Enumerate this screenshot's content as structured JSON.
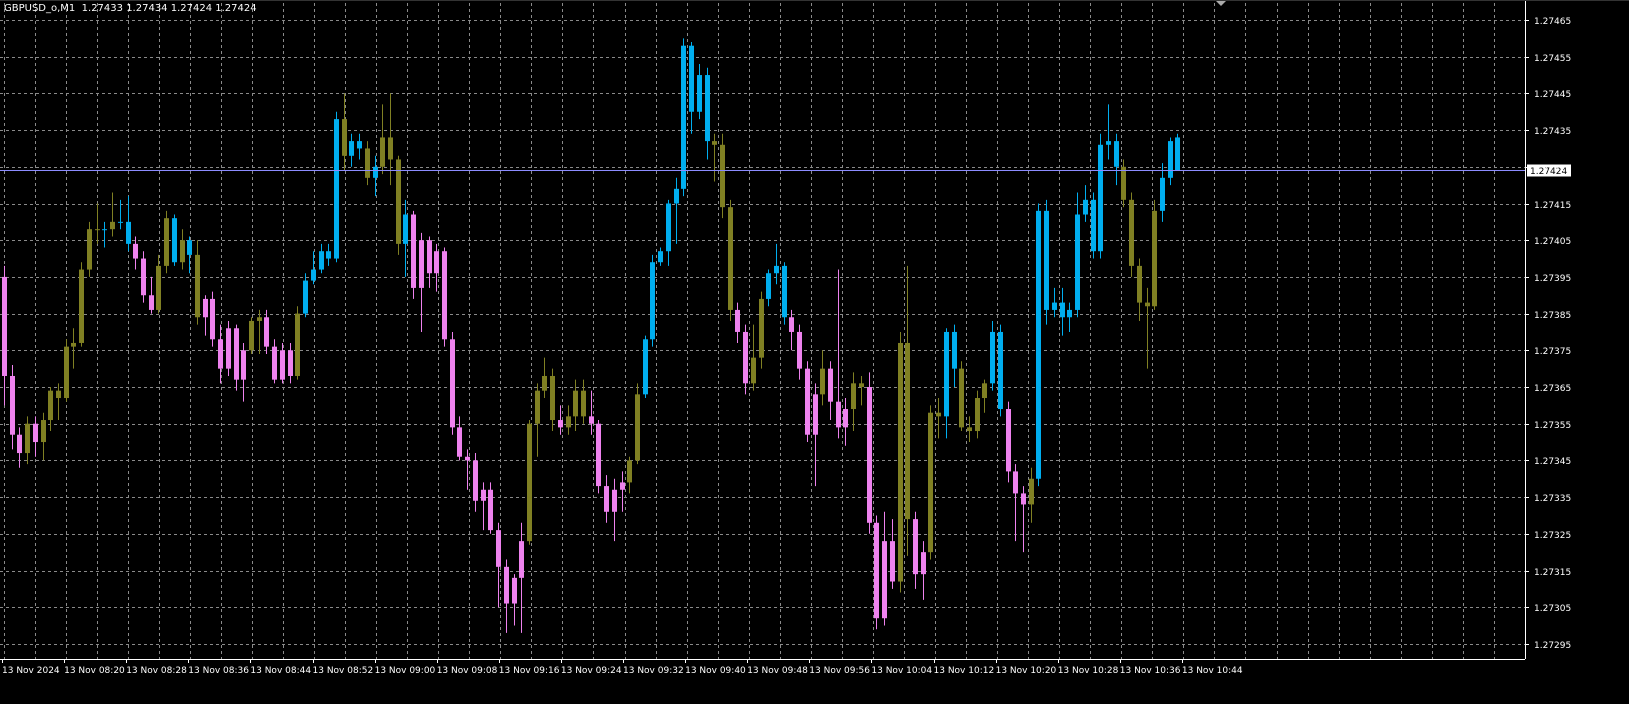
{
  "header": {
    "symbol": "GBPUSD_o,M1",
    "ohlc": "1.27433 1.27434 1.27424 1.27424"
  },
  "current_price_label": "1.27424",
  "colors": {
    "background": "#000000",
    "grid": "#8a8a8a",
    "text": "#ffffff",
    "bull_strong": "#00aeef",
    "bear_strong": "#ee82ee",
    "neutral": "#808023",
    "price_line": "#8c8cff"
  },
  "chart_data": {
    "type": "candlestick",
    "timeframe": "M1",
    "symbol": "GBPUSD_o",
    "y_ticks": [
      "1.27465",
      "1.27455",
      "1.27445",
      "1.27435",
      "1.27425",
      "1.27415",
      "1.27405",
      "1.27395",
      "1.27385",
      "1.27375",
      "1.27365",
      "1.27355",
      "1.27345",
      "1.27335",
      "1.27325",
      "1.27315",
      "1.27305",
      "1.27295"
    ],
    "x_ticks": [
      "13 Nov 2024",
      "13 Nov 08:20",
      "13 Nov 08:28",
      "13 Nov 08:36",
      "13 Nov 08:44",
      "13 Nov 08:52",
      "13 Nov 09:00",
      "13 Nov 09:08",
      "13 Nov 09:16",
      "13 Nov 09:24",
      "13 Nov 09:32",
      "13 Nov 09:40",
      "13 Nov 09:48",
      "13 Nov 09:56",
      "13 Nov 10:04",
      "13 Nov 10:12",
      "13 Nov 10:20",
      "13 Nov 10:28",
      "13 Nov 10:36",
      "13 Nov 10:44"
    ],
    "ylim": [
      1.2729,
      1.27468
    ],
    "grid": true,
    "current_price": 1.27424,
    "candles": [
      [
        1.27395,
        1.27398,
        1.2736,
        1.27368,
        "b"
      ],
      [
        1.27368,
        1.27371,
        1.27348,
        1.27352,
        "b"
      ],
      [
        1.27352,
        1.27354,
        1.27343,
        1.27347,
        "b"
      ],
      [
        1.27347,
        1.27357,
        1.27344,
        1.27355,
        "n"
      ],
      [
        1.27355,
        1.27357,
        1.27346,
        1.2735,
        "b"
      ],
      [
        1.2735,
        1.27358,
        1.27345,
        1.27356,
        "n"
      ],
      [
        1.27356,
        1.27365,
        1.27353,
        1.27364,
        "n"
      ],
      [
        1.27364,
        1.27366,
        1.27356,
        1.27362,
        "n"
      ],
      [
        1.27362,
        1.27378,
        1.27361,
        1.27376,
        "n"
      ],
      [
        1.27376,
        1.27381,
        1.2737,
        1.27377,
        "n"
      ],
      [
        1.27377,
        1.27399,
        1.27376,
        1.27397,
        "n"
      ],
      [
        1.27397,
        1.2741,
        1.27395,
        1.27408,
        "n"
      ],
      [
        1.27408,
        1.27415,
        1.27404,
        1.27408,
        "n"
      ],
      [
        1.27408,
        1.2741,
        1.27403,
        1.27408,
        "u"
      ],
      [
        1.27408,
        1.27418,
        1.27406,
        1.2741,
        "n"
      ],
      [
        1.2741,
        1.27416,
        1.27408,
        1.2741,
        "u"
      ],
      [
        1.2741,
        1.27417,
        1.27402,
        1.27404,
        "u"
      ],
      [
        1.27404,
        1.27406,
        1.27397,
        1.274,
        "b"
      ],
      [
        1.274,
        1.27402,
        1.27388,
        1.2739,
        "b"
      ],
      [
        1.2739,
        1.27395,
        1.27385,
        1.27386,
        "b"
      ],
      [
        1.27386,
        1.27401,
        1.27385,
        1.27398,
        "n"
      ],
      [
        1.27398,
        1.27413,
        1.27396,
        1.27411,
        "n"
      ],
      [
        1.27411,
        1.27412,
        1.27398,
        1.27399,
        "u"
      ],
      [
        1.27399,
        1.27408,
        1.27397,
        1.27405,
        "n"
      ],
      [
        1.27405,
        1.27406,
        1.27396,
        1.27401,
        "u"
      ],
      [
        1.27401,
        1.27405,
        1.27382,
        1.27384,
        "n"
      ],
      [
        1.27384,
        1.2739,
        1.27379,
        1.27389,
        "b"
      ],
      [
        1.27389,
        1.27391,
        1.27376,
        1.27378,
        "b"
      ],
      [
        1.27378,
        1.27382,
        1.27366,
        1.2737,
        "b"
      ],
      [
        1.2737,
        1.27383,
        1.27368,
        1.27381,
        "b"
      ],
      [
        1.27381,
        1.27382,
        1.27364,
        1.27367,
        "b"
      ],
      [
        1.27367,
        1.27377,
        1.27361,
        1.27375,
        "b"
      ],
      [
        1.27375,
        1.27384,
        1.27374,
        1.27383,
        "n"
      ],
      [
        1.27383,
        1.27386,
        1.27374,
        1.27384,
        "n"
      ],
      [
        1.27384,
        1.27386,
        1.27374,
        1.27376,
        "b"
      ],
      [
        1.27376,
        1.27378,
        1.27366,
        1.27367,
        "b"
      ],
      [
        1.27367,
        1.27377,
        1.27366,
        1.27375,
        "b"
      ],
      [
        1.27375,
        1.27377,
        1.27366,
        1.27368,
        "b"
      ],
      [
        1.27368,
        1.27387,
        1.27367,
        1.27385,
        "n"
      ],
      [
        1.27385,
        1.27396,
        1.27384,
        1.27394,
        "u"
      ],
      [
        1.27394,
        1.27402,
        1.27393,
        1.27397,
        "u"
      ],
      [
        1.27397,
        1.27404,
        1.27396,
        1.27402,
        "u"
      ],
      [
        1.27402,
        1.27404,
        1.27398,
        1.274,
        "u"
      ],
      [
        1.274,
        1.2744,
        1.27399,
        1.27438,
        "u"
      ],
      [
        1.27438,
        1.27445,
        1.27424,
        1.27428,
        "n"
      ],
      [
        1.27428,
        1.27434,
        1.27425,
        1.27432,
        "u"
      ],
      [
        1.27432,
        1.27434,
        1.27427,
        1.2743,
        "u"
      ],
      [
        1.2743,
        1.27432,
        1.2742,
        1.27422,
        "n"
      ],
      [
        1.27422,
        1.27428,
        1.27417,
        1.27425,
        "u"
      ],
      [
        1.27425,
        1.27442,
        1.27423,
        1.27433,
        "n"
      ],
      [
        1.27433,
        1.27445,
        1.2742,
        1.27427,
        "n"
      ],
      [
        1.27427,
        1.27428,
        1.27401,
        1.27404,
        "n"
      ],
      [
        1.27404,
        1.27416,
        1.27395,
        1.27412,
        "u"
      ],
      [
        1.27412,
        1.27413,
        1.27389,
        1.27392,
        "b"
      ],
      [
        1.27392,
        1.27407,
        1.2738,
        1.27405,
        "b"
      ],
      [
        1.27405,
        1.27406,
        1.27392,
        1.27396,
        "b"
      ],
      [
        1.27396,
        1.27404,
        1.27391,
        1.27402,
        "b"
      ],
      [
        1.27402,
        1.27403,
        1.27376,
        1.27378,
        "b"
      ],
      [
        1.27378,
        1.2738,
        1.27352,
        1.27354,
        "b"
      ],
      [
        1.27354,
        1.27357,
        1.27345,
        1.27346,
        "b"
      ],
      [
        1.27346,
        1.27348,
        1.27337,
        1.27345,
        "b"
      ],
      [
        1.27345,
        1.27347,
        1.27331,
        1.27334,
        "b"
      ],
      [
        1.27334,
        1.27339,
        1.27326,
        1.27337,
        "b"
      ],
      [
        1.27337,
        1.27339,
        1.27325,
        1.27326,
        "b"
      ],
      [
        1.27326,
        1.27328,
        1.27305,
        1.27316,
        "b"
      ],
      [
        1.27316,
        1.27318,
        1.27298,
        1.27306,
        "b"
      ],
      [
        1.27306,
        1.27314,
        1.273,
        1.27313,
        "b"
      ],
      [
        1.27313,
        1.27328,
        1.27298,
        1.27323,
        "b"
      ],
      [
        1.27323,
        1.27356,
        1.27322,
        1.27355,
        "n"
      ],
      [
        1.27355,
        1.27366,
        1.27346,
        1.27364,
        "n"
      ],
      [
        1.27364,
        1.27373,
        1.27362,
        1.27368,
        "n"
      ],
      [
        1.27368,
        1.2737,
        1.27353,
        1.27356,
        "n"
      ],
      [
        1.27356,
        1.2736,
        1.27352,
        1.27354,
        "b"
      ],
      [
        1.27354,
        1.2736,
        1.27352,
        1.27357,
        "n"
      ],
      [
        1.27357,
        1.27367,
        1.27353,
        1.27364,
        "n"
      ],
      [
        1.27364,
        1.27367,
        1.27355,
        1.27357,
        "n"
      ],
      [
        1.27357,
        1.27364,
        1.27352,
        1.27355,
        "b"
      ],
      [
        1.27355,
        1.27356,
        1.27336,
        1.27338,
        "b"
      ],
      [
        1.27338,
        1.27341,
        1.27328,
        1.27331,
        "b"
      ],
      [
        1.27331,
        1.2734,
        1.27323,
        1.27337,
        "b"
      ],
      [
        1.27337,
        1.27342,
        1.27331,
        1.27339,
        "b"
      ],
      [
        1.27339,
        1.27346,
        1.27336,
        1.27345,
        "n"
      ],
      [
        1.27345,
        1.27366,
        1.27344,
        1.27363,
        "n"
      ],
      [
        1.27363,
        1.27379,
        1.27362,
        1.27378,
        "u"
      ],
      [
        1.27378,
        1.27401,
        1.27376,
        1.27399,
        "u"
      ],
      [
        1.27399,
        1.27403,
        1.27398,
        1.27402,
        "u"
      ],
      [
        1.27402,
        1.27416,
        1.27398,
        1.27415,
        "u"
      ],
      [
        1.27415,
        1.27422,
        1.27404,
        1.27419,
        "u"
      ],
      [
        1.27419,
        1.2746,
        1.27417,
        1.27458,
        "u"
      ],
      [
        1.27458,
        1.27459,
        1.27434,
        1.2744,
        "u"
      ],
      [
        1.2744,
        1.27453,
        1.27438,
        1.2745,
        "u"
      ],
      [
        1.2745,
        1.27452,
        1.27427,
        1.27432,
        "u"
      ],
      [
        1.27432,
        1.27434,
        1.27421,
        1.27431,
        "n"
      ],
      [
        1.27431,
        1.27434,
        1.27411,
        1.27414,
        "n"
      ],
      [
        1.27414,
        1.27416,
        1.27383,
        1.27386,
        "n"
      ],
      [
        1.27386,
        1.27388,
        1.27377,
        1.2738,
        "b"
      ],
      [
        1.2738,
        1.27382,
        1.27363,
        1.27366,
        "b"
      ],
      [
        1.27366,
        1.27382,
        1.27364,
        1.27373,
        "n"
      ],
      [
        1.27373,
        1.27391,
        1.2737,
        1.27389,
        "n"
      ],
      [
        1.27389,
        1.27397,
        1.27387,
        1.27396,
        "u"
      ],
      [
        1.27396,
        1.27404,
        1.27393,
        1.27398,
        "u"
      ],
      [
        1.27398,
        1.27399,
        1.27382,
        1.27384,
        "u"
      ],
      [
        1.27384,
        1.27386,
        1.27375,
        1.2738,
        "b"
      ],
      [
        1.2738,
        1.27382,
        1.27367,
        1.2737,
        "b"
      ],
      [
        1.2737,
        1.27372,
        1.2735,
        1.27352,
        "b"
      ],
      [
        1.27352,
        1.27366,
        1.27338,
        1.27363,
        "b"
      ],
      [
        1.27363,
        1.27375,
        1.2736,
        1.2737,
        "n"
      ],
      [
        1.2737,
        1.27372,
        1.27356,
        1.27361,
        "b"
      ],
      [
        1.27361,
        1.27397,
        1.27351,
        1.27354,
        "b"
      ],
      [
        1.27354,
        1.27362,
        1.27349,
        1.27359,
        "b"
      ],
      [
        1.27359,
        1.27369,
        1.27353,
        1.27366,
        "n"
      ],
      [
        1.27366,
        1.27368,
        1.2736,
        1.27365,
        "n"
      ],
      [
        1.27365,
        1.27369,
        1.27325,
        1.27328,
        "b"
      ],
      [
        1.27328,
        1.2733,
        1.27299,
        1.27302,
        "b"
      ],
      [
        1.27302,
        1.27331,
        1.273,
        1.27323,
        "b"
      ],
      [
        1.27323,
        1.27329,
        1.2731,
        1.27312,
        "b"
      ],
      [
        1.27312,
        1.2738,
        1.27309,
        1.27377,
        "n"
      ],
      [
        1.27377,
        1.27398,
        1.27319,
        1.27329,
        "n"
      ],
      [
        1.27329,
        1.27331,
        1.2731,
        1.27314,
        "b"
      ],
      [
        1.27314,
        1.27323,
        1.27307,
        1.2732,
        "b"
      ],
      [
        1.2732,
        1.2736,
        1.27318,
        1.27358,
        "n"
      ],
      [
        1.27358,
        1.27362,
        1.27351,
        1.27357,
        "n"
      ],
      [
        1.27357,
        1.27381,
        1.27351,
        1.2738,
        "u"
      ],
      [
        1.2738,
        1.27382,
        1.27365,
        1.2737,
        "u"
      ],
      [
        1.2737,
        1.27372,
        1.27353,
        1.27354,
        "n"
      ],
      [
        1.27354,
        1.27357,
        1.2735,
        1.27353,
        "n"
      ],
      [
        1.27353,
        1.27364,
        1.27351,
        1.27362,
        "n"
      ],
      [
        1.27362,
        1.27367,
        1.27358,
        1.27366,
        "n"
      ],
      [
        1.27366,
        1.27383,
        1.27364,
        1.2738,
        "u"
      ],
      [
        1.2738,
        1.27382,
        1.27357,
        1.27359,
        "u"
      ],
      [
        1.27359,
        1.27361,
        1.27339,
        1.27342,
        "b"
      ],
      [
        1.27342,
        1.27344,
        1.27323,
        1.27336,
        "b"
      ],
      [
        1.27336,
        1.27338,
        1.2732,
        1.27333,
        "b"
      ],
      [
        1.27333,
        1.27343,
        1.27328,
        1.2734,
        "n"
      ],
      [
        1.2734,
        1.27415,
        1.27338,
        1.27413,
        "u"
      ],
      [
        1.27413,
        1.27416,
        1.27382,
        1.27386,
        "u"
      ],
      [
        1.27386,
        1.27392,
        1.27384,
        1.27388,
        "u"
      ],
      [
        1.27388,
        1.27392,
        1.27379,
        1.27384,
        "u"
      ],
      [
        1.27384,
        1.27388,
        1.2738,
        1.27386,
        "u"
      ],
      [
        1.27386,
        1.27418,
        1.27384,
        1.27412,
        "u"
      ],
      [
        1.27412,
        1.2742,
        1.2741,
        1.27416,
        "u"
      ],
      [
        1.27416,
        1.27418,
        1.274,
        1.27402,
        "u"
      ],
      [
        1.27402,
        1.27434,
        1.274,
        1.27431,
        "u"
      ],
      [
        1.27431,
        1.27442,
        1.27427,
        1.27432,
        "u"
      ],
      [
        1.27432,
        1.27434,
        1.2742,
        1.27425,
        "u"
      ],
      [
        1.27425,
        1.27427,
        1.27414,
        1.27416,
        "n"
      ],
      [
        1.27416,
        1.27418,
        1.27395,
        1.27398,
        "n"
      ],
      [
        1.27398,
        1.274,
        1.27383,
        1.27388,
        "n"
      ],
      [
        1.27388,
        1.27392,
        1.2737,
        1.27387,
        "n"
      ],
      [
        1.27387,
        1.27416,
        1.27386,
        1.27413,
        "n"
      ],
      [
        1.27413,
        1.27426,
        1.2741,
        1.27422,
        "u"
      ],
      [
        1.27422,
        1.27433,
        1.2742,
        1.27432,
        "u"
      ],
      [
        1.27433,
        1.27434,
        1.27424,
        1.27424,
        "u"
      ]
    ]
  },
  "price_axis_labels": [
    "1.27465",
    "1.27455",
    "1.27445",
    "1.27435",
    "1.27425",
    "1.27415",
    "1.27405",
    "1.27395",
    "1.27385",
    "1.27375",
    "1.27365",
    "1.27355",
    "1.27345",
    "1.27335",
    "1.27325",
    "1.27315",
    "1.27305",
    "1.27295"
  ],
  "time_axis_labels": [
    "13 Nov 2024",
    "13 Nov 08:20",
    "13 Nov 08:28",
    "13 Nov 08:36",
    "13 Nov 08:44",
    "13 Nov 08:52",
    "13 Nov 09:00",
    "13 Nov 09:08",
    "13 Nov 09:16",
    "13 Nov 09:24",
    "13 Nov 09:32",
    "13 Nov 09:40",
    "13 Nov 09:48",
    "13 Nov 09:56",
    "13 Nov 10:04",
    "13 Nov 10:12",
    "13 Nov 10:20",
    "13 Nov 10:28",
    "13 Nov 10:36",
    "13 Nov 10:44"
  ]
}
